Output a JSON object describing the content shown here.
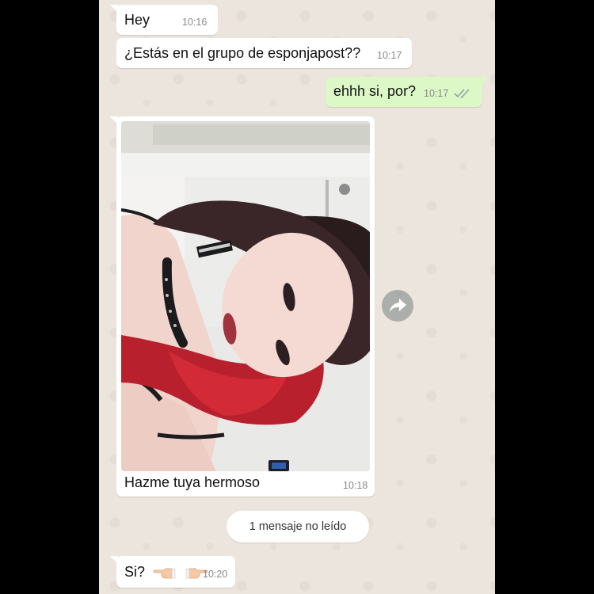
{
  "messages": [
    {
      "text": "Hey",
      "time": "10:16"
    },
    {
      "text": "¿Estás en el grupo de esponjapost??",
      "time": "10:17"
    },
    {
      "text": "ehhh si, por?",
      "time": "10:17"
    },
    {
      "caption": "Hazme tuya hermoso",
      "time": "10:18"
    },
    {
      "text": "Si?",
      "time": "10:20"
    }
  ],
  "unread_banner": "1 mensaje no leído",
  "icons": {
    "ticks": "double-check-read-icon",
    "forward": "forward-arrow-icon",
    "emoji": "pointing-hand-emoji-icon"
  },
  "colors": {
    "chat_background": "#ece5dd",
    "incoming_bubble": "#ffffff",
    "outgoing_bubble": "#dcf8c6",
    "read_ticks": "#8fa3a8"
  }
}
